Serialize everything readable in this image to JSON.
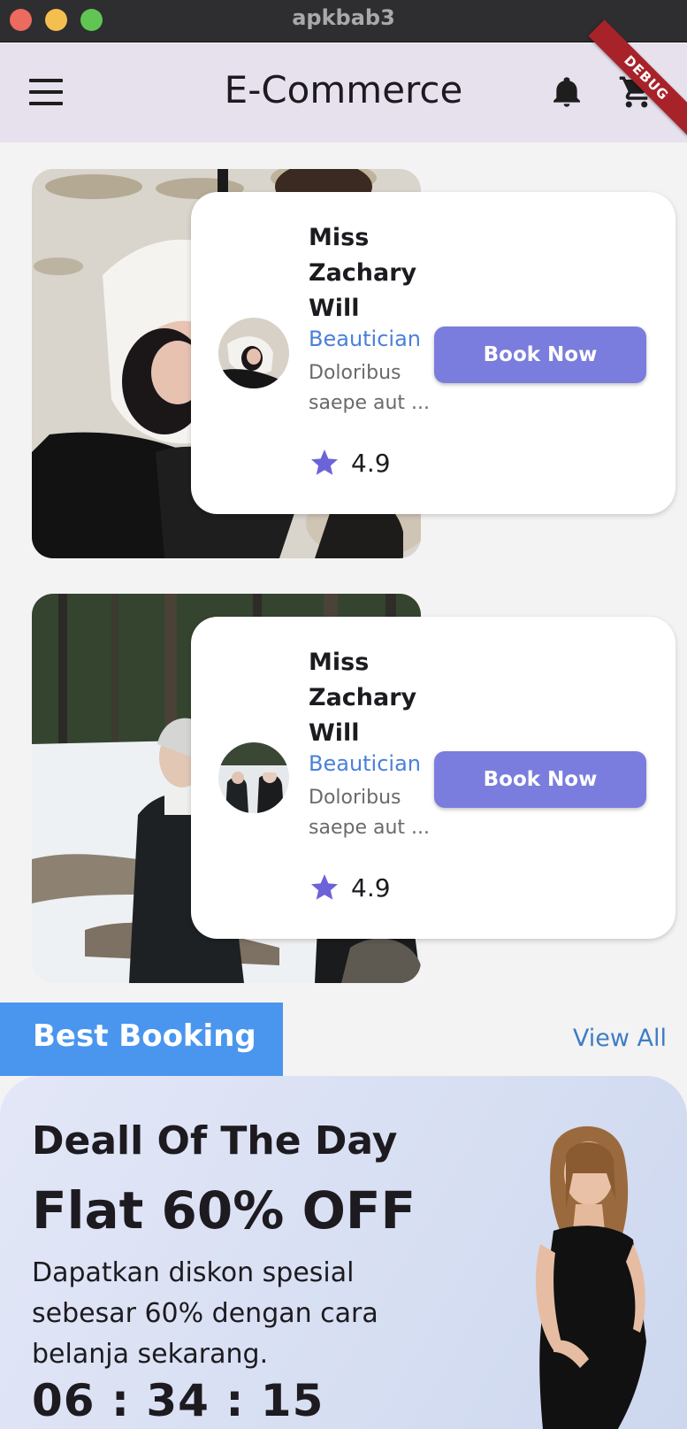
{
  "window": {
    "title": "apkbab3"
  },
  "appbar": {
    "title": "E-Commerce",
    "debug_label": "DEBUG"
  },
  "stylists": [
    {
      "name": "Miss Zachary Will",
      "role": "Beautician",
      "description": "Doloribus saepe aut ...",
      "rating": "4.9",
      "button": "Book Now"
    },
    {
      "name": "Miss Zachary Will",
      "role": "Beautician",
      "description": "Doloribus saepe aut ...",
      "rating": "4.9",
      "button": "Book Now"
    }
  ],
  "best_booking": {
    "label": "Best Booking",
    "view_all": "View All"
  },
  "deal": {
    "title": "Deall Of The Day",
    "headline": "Flat 60% OFF",
    "description": "Dapatkan diskon spesial sebesar 60% dengan cara belanja sekarang.",
    "timer": "06 : 34 : 15"
  },
  "colors": {
    "accent": "#7a7ddd",
    "tab_blue": "#4a96ee",
    "link_blue": "#3f7dc4",
    "star": "#6d63d9",
    "appbar": "#e7e1ee"
  }
}
